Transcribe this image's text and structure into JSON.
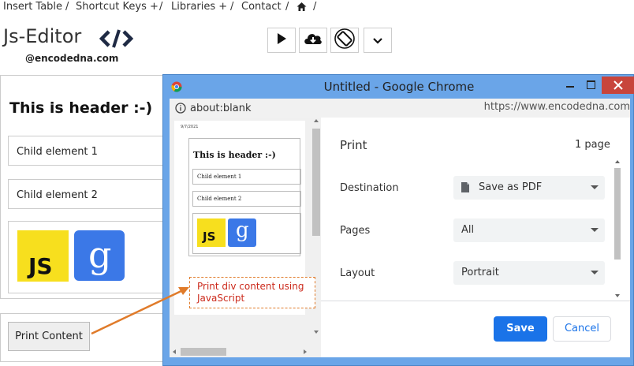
{
  "nav": {
    "items": [
      "Insert Table",
      "/",
      "Shortcut Keys +",
      "/",
      "Libraries +",
      "/",
      "Contact",
      "/",
      "/"
    ],
    "home_icon": "home-icon"
  },
  "brand": {
    "title": "Js-Editor",
    "handle": "@encodedna.com"
  },
  "toolbar": {
    "icons": [
      "play-icon",
      "cloud-download-icon",
      "rotate-screen-icon",
      "chevron-down-icon"
    ]
  },
  "page": {
    "header": "This is header :-)",
    "children": [
      "Child element 1",
      "Child element 2"
    ],
    "logos": [
      "JS",
      "g"
    ],
    "print_button": "Print Content"
  },
  "chrome": {
    "title": "Untitled - Google Chrome",
    "address": "about:blank",
    "watermark": "https://www.encodedna.com"
  },
  "preview": {
    "date": "9/7/2021",
    "header": "This is header :-)",
    "children": [
      "Child element 1",
      "Child element 2"
    ]
  },
  "print_dialog": {
    "title": "Print",
    "page_count": "1 page",
    "rows": [
      {
        "label": "Destination",
        "value": "Save as PDF"
      },
      {
        "label": "Pages",
        "value": "All"
      },
      {
        "label": "Layout",
        "value": "Portrait"
      }
    ],
    "save": "Save",
    "cancel": "Cancel"
  },
  "annotation": {
    "line1": "Print div content using",
    "line2": "JavaScript"
  },
  "colors": {
    "chrome_frame": "#6aa5e8",
    "save_blue": "#1a73e8",
    "annotation_orange": "#e07b2a",
    "js_yellow": "#f7df1e",
    "google_blue": "#3b78e7"
  }
}
